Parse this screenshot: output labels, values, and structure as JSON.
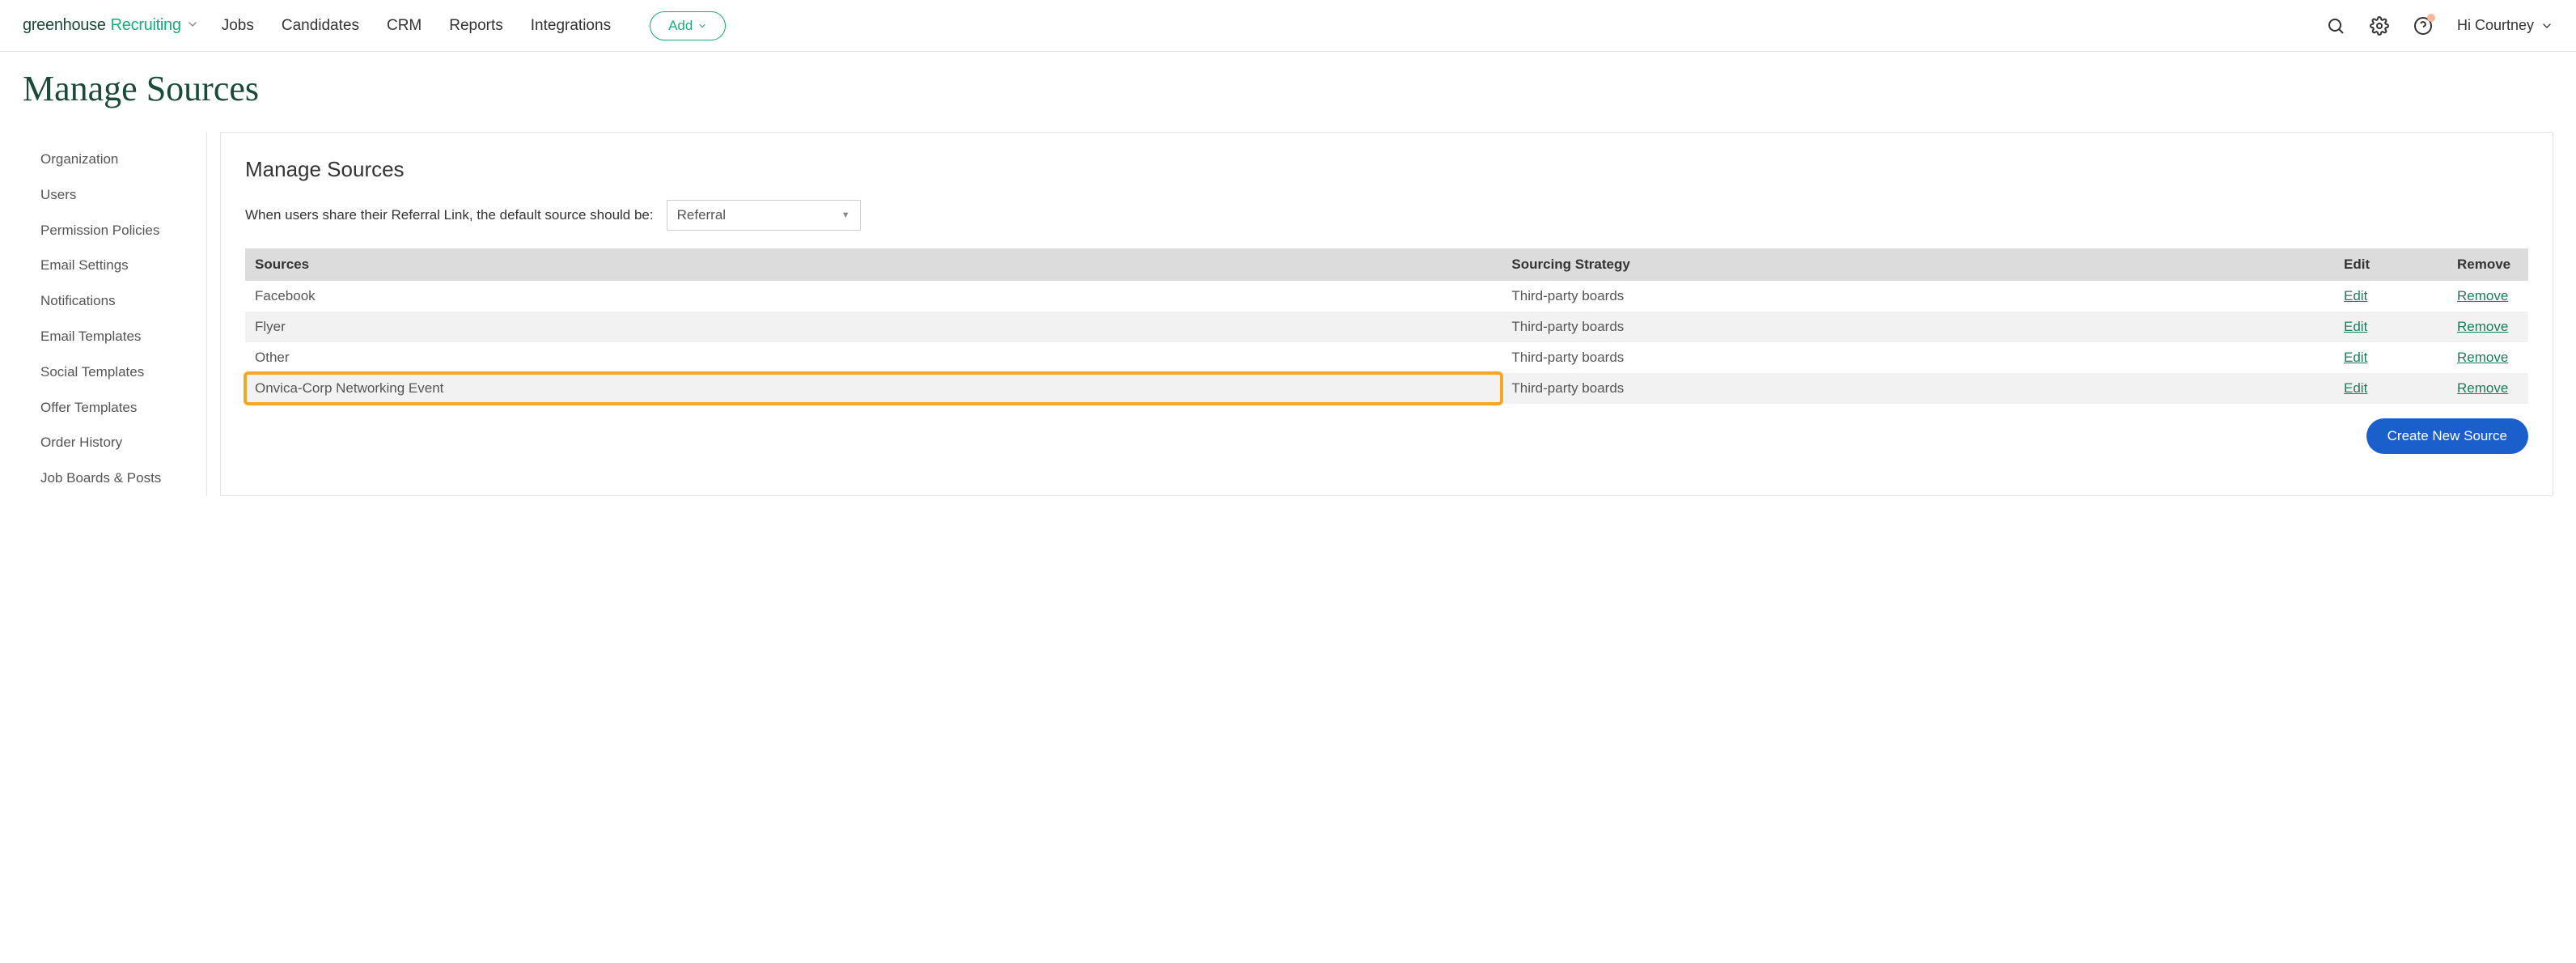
{
  "header": {
    "logo_part1": "greenhouse",
    "logo_part2": "Recruiting",
    "nav": [
      "Jobs",
      "Candidates",
      "CRM",
      "Reports",
      "Integrations"
    ],
    "add_label": "Add",
    "user_greeting": "Hi Courtney"
  },
  "page": {
    "title": "Manage Sources"
  },
  "sidebar": {
    "items": [
      "Organization",
      "Users",
      "Permission Policies",
      "Email Settings",
      "Notifications",
      "Email Templates",
      "Social Templates",
      "Offer Templates",
      "Order History",
      "Job Boards & Posts"
    ]
  },
  "main": {
    "heading": "Manage Sources",
    "referral_label": "When users share their Referral Link, the default source should be:",
    "referral_select_value": "Referral",
    "table": {
      "headers": {
        "sources": "Sources",
        "strategy": "Sourcing Strategy",
        "edit": "Edit",
        "remove": "Remove"
      },
      "edit_label": "Edit",
      "remove_label": "Remove",
      "rows": [
        {
          "source": "Facebook",
          "strategy": "Third-party boards",
          "highlighted": false
        },
        {
          "source": "Flyer",
          "strategy": "Third-party boards",
          "highlighted": false
        },
        {
          "source": "Other",
          "strategy": "Third-party boards",
          "highlighted": false
        },
        {
          "source": "Onvica-Corp Networking Event",
          "strategy": "Third-party boards",
          "highlighted": true
        }
      ]
    },
    "create_button": "Create New Source"
  }
}
